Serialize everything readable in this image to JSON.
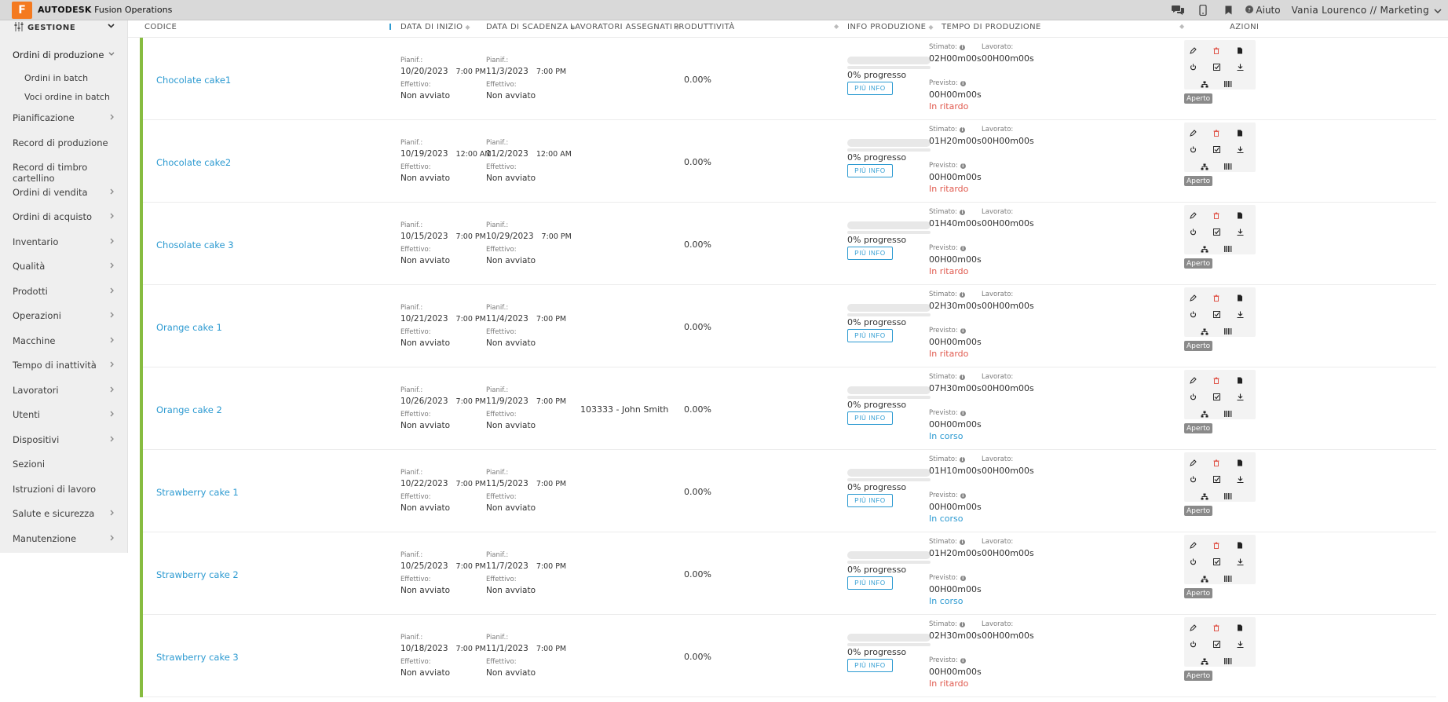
{
  "topbar": {
    "logo_letter": "F",
    "brand_bold": "AUTODESK",
    "brand_rest": "Fusion Operations",
    "help_label": "Aiuto",
    "user_label": "Vania Lourenco //  Marketing",
    "icons": [
      "chat-icon",
      "mobile-icon",
      "bookmark-icon",
      "help-icon",
      "chevron-down-icon"
    ]
  },
  "sidebar": {
    "header": "GESTIONE",
    "items": [
      {
        "label": "Ordini di produzione",
        "active": true,
        "arrow": "chevron-down"
      },
      {
        "label": "Ordini in batch",
        "sub": true
      },
      {
        "label": "Voci ordine in batch",
        "sub": true
      },
      {
        "label": "Pianificazione",
        "arrow": "chevron-right"
      },
      {
        "label": "Record di produzione"
      },
      {
        "label": "Record di timbro cartellino"
      },
      {
        "label": "Ordini di vendita",
        "arrow": "chevron-right"
      },
      {
        "label": "Ordini di acquisto",
        "arrow": "chevron-right"
      },
      {
        "label": "Inventario",
        "arrow": "chevron-right"
      },
      {
        "label": "Qualità",
        "arrow": "chevron-right"
      },
      {
        "label": "Prodotti",
        "arrow": "chevron-right"
      },
      {
        "label": "Operazioni",
        "arrow": "chevron-right"
      },
      {
        "label": "Macchine",
        "arrow": "chevron-right"
      },
      {
        "label": "Tempo di inattività",
        "arrow": "chevron-right"
      },
      {
        "label": "Lavoratori",
        "arrow": "chevron-right"
      },
      {
        "label": "Utenti",
        "arrow": "chevron-right"
      },
      {
        "label": "Dispositivi",
        "arrow": "chevron-right"
      },
      {
        "label": "Sezioni"
      },
      {
        "label": "Istruzioni di lavoro"
      },
      {
        "label": "Salute e sicurezza",
        "arrow": "chevron-right"
      },
      {
        "label": "Manutenzione",
        "arrow": "chevron-right"
      }
    ]
  },
  "table": {
    "columns": [
      "CODICE",
      "DATA DI INIZIO",
      "DATA DI SCADENZA",
      "LAVORATORI ASSEGNATI",
      "PRODUTTIVITÀ",
      "INFO PRODUZIONE",
      "TEMPO DI PRODUZIONE",
      "AZIONI"
    ],
    "labels": {
      "planned": "Pianif.:",
      "actual": "Effettivo:",
      "not_started": "Non avviato",
      "progress": "0% progresso",
      "more_info": "PIÙ INFO",
      "estimated": "Stimato:",
      "worked": "Lavorato:",
      "forecast": "Previsto:",
      "open_badge": "Aperto"
    },
    "rows": [
      {
        "code": "Chocolate cake1",
        "start_date": "10/20/2023",
        "start_time": "7:00 PM",
        "due_date": "11/3/2023",
        "due_time": "7:00 PM",
        "worker": "",
        "productivity": "0.00%",
        "estimated": "02H00m00s",
        "worked": "00H00m00s",
        "forecast": "00H00m00s",
        "status": "In ritardo",
        "status_color": "#e05a4f"
      },
      {
        "code": "Chocolate cake2",
        "start_date": "10/19/2023",
        "start_time": "12:00 AM",
        "due_date": "11/2/2023",
        "due_time": "12:00 AM",
        "worker": "",
        "productivity": "0.00%",
        "estimated": "01H20m00s",
        "worked": "00H00m00s",
        "forecast": "00H00m00s",
        "status": "In ritardo",
        "status_color": "#e05a4f"
      },
      {
        "code": "Chosolate cake 3",
        "start_date": "10/15/2023",
        "start_time": "7:00 PM",
        "due_date": "10/29/2023",
        "due_time": "7:00 PM",
        "worker": "",
        "productivity": "0.00%",
        "estimated": "01H40m00s",
        "worked": "00H00m00s",
        "forecast": "00H00m00s",
        "status": "In ritardo",
        "status_color": "#e05a4f"
      },
      {
        "code": "Orange cake 1",
        "start_date": "10/21/2023",
        "start_time": "7:00 PM",
        "due_date": "11/4/2023",
        "due_time": "7:00 PM",
        "worker": "",
        "productivity": "0.00%",
        "estimated": "02H30m00s",
        "worked": "00H00m00s",
        "forecast": "00H00m00s",
        "status": "In ritardo",
        "status_color": "#e05a4f"
      },
      {
        "code": "Orange cake 2",
        "start_date": "10/26/2023",
        "start_time": "7:00 PM",
        "due_date": "11/9/2023",
        "due_time": "7:00 PM",
        "worker": "103333 - John Smith",
        "productivity": "0.00%",
        "estimated": "07H30m00s",
        "worked": "00H00m00s",
        "forecast": "00H00m00s",
        "status": "In corso",
        "status_color": "#2c9ad1"
      },
      {
        "code": "Strawberry cake 1",
        "start_date": "10/22/2023",
        "start_time": "7:00 PM",
        "due_date": "11/5/2023",
        "due_time": "7:00 PM",
        "worker": "",
        "productivity": "0.00%",
        "estimated": "01H10m00s",
        "worked": "00H00m00s",
        "forecast": "00H00m00s",
        "status": "In corso",
        "status_color": "#2c9ad1"
      },
      {
        "code": "Strawberry cake 2",
        "start_date": "10/25/2023",
        "start_time": "7:00 PM",
        "due_date": "11/7/2023",
        "due_time": "7:00 PM",
        "worker": "",
        "productivity": "0.00%",
        "estimated": "01H20m00s",
        "worked": "00H00m00s",
        "forecast": "00H00m00s",
        "status": "In corso",
        "status_color": "#2c9ad1"
      },
      {
        "code": "Strawberry cake 3",
        "start_date": "10/18/2023",
        "start_time": "7:00 PM",
        "due_date": "11/1/2023",
        "due_time": "7:00 PM",
        "worker": "",
        "productivity": "0.00%",
        "estimated": "02H30m00s",
        "worked": "00H00m00s",
        "forecast": "00H00m00s",
        "status": "In ritardo",
        "status_color": "#e05a4f"
      }
    ]
  },
  "colors": {
    "accent": "#2c9ad1",
    "row_bar": "#87bc40",
    "late": "#e05a4f",
    "brand": "#f47a20"
  }
}
